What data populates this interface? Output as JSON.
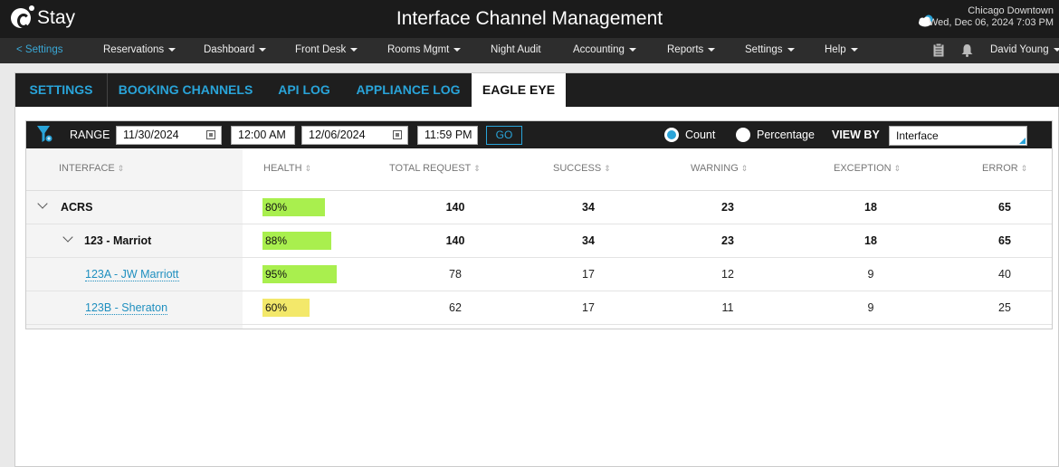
{
  "app": {
    "logo_text": "Stay",
    "title": "Interface Channel Management",
    "location": "Chicago Downtown",
    "datetime": "Wed, Dec 06, 2024 7:03 PM"
  },
  "nav": {
    "back": "< Settings",
    "items": [
      "Reservations",
      "Dashboard",
      "Front Desk",
      "Rooms Mgmt",
      "Night Audit",
      "Accounting",
      "Reports",
      "Settings",
      "Help"
    ],
    "user": "David Young"
  },
  "tabs": [
    "SETTINGS",
    "BOOKING CHANNELS",
    "API LOG",
    "APPLIANCE LOG",
    "EAGLE EYE"
  ],
  "active_tab": "EAGLE EYE",
  "filter": {
    "range_label": "RANGE",
    "start_date": "11/30/2024",
    "start_time": "12:00 AM",
    "end_date": "12/06/2024",
    "end_time": "11:59 PM",
    "go_label": "GO",
    "count_label": "Count",
    "percentage_label": "Percentage",
    "selected_mode": "Count",
    "view_by_label": "VIEW BY",
    "view_by_value": "Interface"
  },
  "table": {
    "headers": [
      "INTERFACE",
      "HEALTH",
      "TOTAL REQUEST",
      "SUCCESS",
      "WARNING",
      "EXCEPTION",
      "ERROR"
    ],
    "rows": [
      {
        "name": "ACRS",
        "level": 0,
        "expanded": true,
        "health": "80%",
        "health_value": 80,
        "health_color": "#a9ef4e",
        "total": "140",
        "success": "34",
        "warning": "23",
        "exception": "18",
        "error": "65"
      },
      {
        "name": "123 - Marriot",
        "level": 1,
        "expanded": true,
        "health": "88%",
        "health_value": 88,
        "health_color": "#a9ef4e",
        "total": "140",
        "success": "34",
        "warning": "23",
        "exception": "18",
        "error": "65"
      },
      {
        "name": "123A - JW Marriott",
        "level": 2,
        "health": "95%",
        "health_value": 95,
        "health_color": "#a9ef4e",
        "total": "78",
        "success": "17",
        "warning": "12",
        "exception": "9",
        "error": "40"
      },
      {
        "name": "123B - Sheraton",
        "level": 2,
        "health": "60%",
        "health_value": 60,
        "health_color": "#f3e86a",
        "total": "62",
        "success": "17",
        "warning": "11",
        "exception": "9",
        "error": "25"
      }
    ]
  },
  "colors": {
    "accent": "#29a4d9",
    "topbar": "#1b1b1b",
    "navbar": "#2d2d2d"
  }
}
